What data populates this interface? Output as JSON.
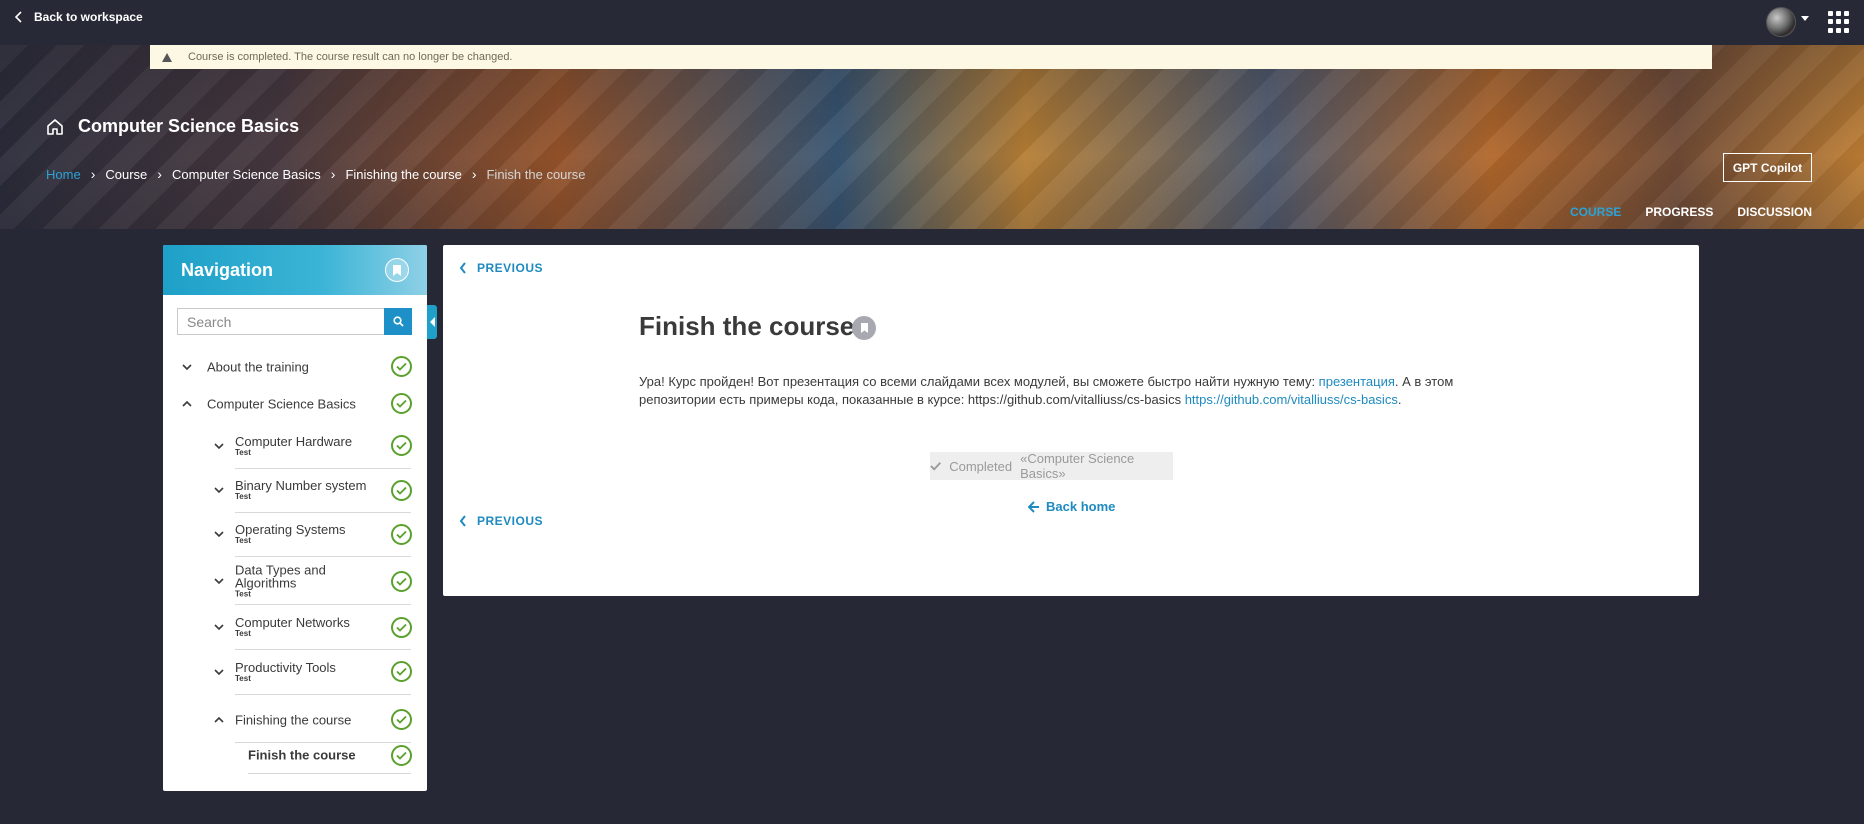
{
  "topbar": {
    "back_label": "Back to workspace",
    "avatar_icon": "user-avatar",
    "apps_icon": "grid-apps-icon"
  },
  "notice": {
    "text": "Course is completed. The course result can no longer be changed."
  },
  "header": {
    "course_title": "Computer Science Basics",
    "breadcrumb": [
      "Home",
      "Course",
      "Computer Science Basics",
      "Finishing the course",
      "Finish the course"
    ],
    "gpt_button": "GPT Copilot",
    "tabs": [
      "COURSE",
      "PROGRESS",
      "DISCUSSION"
    ],
    "active_tab": "COURSE"
  },
  "navigation": {
    "title": "Navigation",
    "search_placeholder": "Search",
    "items": [
      {
        "label": "About the training",
        "sub": "",
        "level": 0,
        "expanded": false,
        "completed": true
      },
      {
        "label": "Computer Science Basics",
        "sub": "",
        "level": 0,
        "expanded": true,
        "completed": true
      },
      {
        "label": "Computer Hardware",
        "sub": "Test",
        "level": 1,
        "expanded": false,
        "completed": true
      },
      {
        "label": "Binary Number system",
        "sub": "Test",
        "level": 1,
        "expanded": false,
        "completed": true
      },
      {
        "label": "Operating Systems",
        "sub": "Test",
        "level": 1,
        "expanded": false,
        "completed": true
      },
      {
        "label": "Data Types and Algorithms",
        "sub": "Test",
        "level": 1,
        "expanded": false,
        "completed": true
      },
      {
        "label": "Computer Networks",
        "sub": "Test",
        "level": 1,
        "expanded": false,
        "completed": true
      },
      {
        "label": "Productivity Tools",
        "sub": "Test",
        "level": 1,
        "expanded": false,
        "completed": true
      },
      {
        "label": "Finishing the course",
        "sub": "",
        "level": 1,
        "expanded": true,
        "completed": true
      },
      {
        "label": "Finish the course",
        "sub": "",
        "level": 2,
        "expanded": false,
        "completed": true
      }
    ]
  },
  "main": {
    "previous_label": "PREVIOUS",
    "title": "Finish the course",
    "body_part1": "Ура! Курс пройден! Вот презентация со всеми слайдами всех модулей, вы сможете быстро найти нужную тему: ",
    "body_link1": "презентация",
    "body_part2": ". А в этом репозитории есть примеры кода, показанные в курсе: https://github.com/vitalliuss/cs-basics ",
    "body_link2": "https://github.com/vitalliuss/cs-basics",
    "body_part3": ".",
    "completed_label": "Completed",
    "completed_course": "«Computer Science Basics»",
    "back_home_label": "Back home"
  },
  "colors": {
    "accent": "#1e8ac0",
    "check": "#5aa02c",
    "background": "#262836"
  }
}
